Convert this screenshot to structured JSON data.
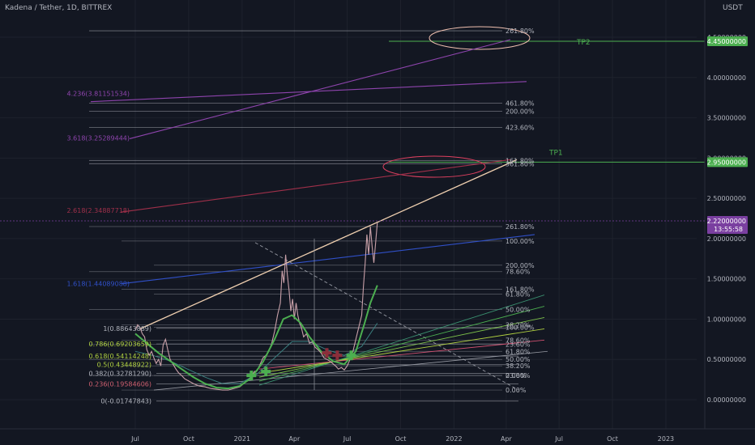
{
  "header": {
    "symbol_title": "Kadena / Tether, 1D, BITTREX",
    "currency": "USDT"
  },
  "colors": {
    "background": "#131722",
    "grid": "#1e222d",
    "axis_text": "#b2b5be",
    "fib_line": "#9598a1",
    "trend_line": "#f0d0b0",
    "candle": "#c8a0a8",
    "green_ma": "#4caf50",
    "buy_marker": "#4caf50",
    "sell_marker": "#8b2e3a",
    "ext_purple": "#8e44ad",
    "ext_blue": "#3050c8",
    "ext_red": "#a0304a",
    "tp_green": "#4caf50",
    "price_label": "#7a3fa0"
  },
  "chart_data": {
    "type": "line",
    "title": "Kadena / Tether, 1D, BITTREX",
    "xlabel": "",
    "ylabel": "USDT",
    "ylim": [
      -0.12,
      4.95
    ],
    "y_ticks": [
      {
        "value": 0.0,
        "label": "0.00000000"
      },
      {
        "value": 0.5,
        "label": "0.50000000"
      },
      {
        "value": 1.0,
        "label": "1.00000000"
      },
      {
        "value": 1.5,
        "label": "1.50000000"
      },
      {
        "value": 2.0,
        "label": "2.00000000"
      },
      {
        "value": 2.5,
        "label": "2.50000000"
      },
      {
        "value": 3.0,
        "label": "3.00000000"
      },
      {
        "value": 3.5,
        "label": "3.50000000"
      },
      {
        "value": 4.0,
        "label": "4.00000000"
      },
      {
        "value": 4.5,
        "label": "4.50000000"
      }
    ],
    "x_ticks": [
      {
        "t": 0,
        "label": "Jul"
      },
      {
        "t": 92,
        "label": "Oct"
      },
      {
        "t": 184,
        "label": "2021"
      },
      {
        "t": 274,
        "label": "Apr"
      },
      {
        "t": 365,
        "label": "Jul"
      },
      {
        "t": 457,
        "label": "Oct"
      },
      {
        "t": 549,
        "label": "2022"
      },
      {
        "t": 639,
        "label": "Apr"
      },
      {
        "t": 730,
        "label": "Jul"
      },
      {
        "t": 822,
        "label": "Oct"
      },
      {
        "t": 914,
        "label": "2023"
      }
    ],
    "price_series": [
      [
        0,
        0.86
      ],
      [
        4,
        0.93
      ],
      [
        8,
        0.9
      ],
      [
        12,
        0.82
      ],
      [
        16,
        0.78
      ],
      [
        20,
        0.62
      ],
      [
        24,
        0.55
      ],
      [
        28,
        0.6
      ],
      [
        32,
        0.52
      ],
      [
        36,
        0.45
      ],
      [
        40,
        0.5
      ],
      [
        44,
        0.42
      ],
      [
        48,
        0.68
      ],
      [
        52,
        0.75
      ],
      [
        56,
        0.62
      ],
      [
        60,
        0.5
      ],
      [
        65,
        0.44
      ],
      [
        70,
        0.38
      ],
      [
        75,
        0.33
      ],
      [
        80,
        0.3
      ],
      [
        85,
        0.26
      ],
      [
        90,
        0.24
      ],
      [
        95,
        0.22
      ],
      [
        100,
        0.2
      ],
      [
        110,
        0.17
      ],
      [
        120,
        0.16
      ],
      [
        130,
        0.14
      ],
      [
        140,
        0.13
      ],
      [
        150,
        0.12
      ],
      [
        160,
        0.12
      ],
      [
        170,
        0.14
      ],
      [
        180,
        0.16
      ],
      [
        190,
        0.22
      ],
      [
        200,
        0.28
      ],
      [
        205,
        0.35
      ],
      [
        210,
        0.36
      ],
      [
        215,
        0.44
      ],
      [
        220,
        0.52
      ],
      [
        225,
        0.55
      ],
      [
        230,
        0.6
      ],
      [
        235,
        0.7
      ],
      [
        240,
        0.85
      ],
      [
        245,
        1.05
      ],
      [
        250,
        1.2
      ],
      [
        253,
        1.6
      ],
      [
        256,
        1.45
      ],
      [
        259,
        1.8
      ],
      [
        262,
        1.55
      ],
      [
        265,
        1.35
      ],
      [
        268,
        1.1
      ],
      [
        271,
        1.25
      ],
      [
        274,
        1.0
      ],
      [
        277,
        1.2
      ],
      [
        280,
        1.05
      ],
      [
        283,
        0.95
      ],
      [
        286,
        0.9
      ],
      [
        290,
        0.78
      ],
      [
        295,
        0.82
      ],
      [
        300,
        0.7
      ],
      [
        305,
        0.72
      ],
      [
        310,
        0.65
      ],
      [
        315,
        0.62
      ],
      [
        320,
        0.58
      ],
      [
        325,
        0.52
      ],
      [
        330,
        0.5
      ],
      [
        335,
        0.48
      ],
      [
        340,
        0.45
      ],
      [
        345,
        0.42
      ],
      [
        350,
        0.38
      ],
      [
        355,
        0.4
      ],
      [
        360,
        0.37
      ],
      [
        365,
        0.42
      ],
      [
        370,
        0.5
      ],
      [
        375,
        0.6
      ],
      [
        380,
        0.75
      ],
      [
        385,
        0.9
      ],
      [
        390,
        1.05
      ],
      [
        393,
        1.4
      ],
      [
        396,
        1.7
      ],
      [
        399,
        2.05
      ],
      [
        402,
        1.8
      ],
      [
        405,
        2.15
      ],
      [
        408,
        1.9
      ],
      [
        411,
        1.7
      ],
      [
        414,
        1.95
      ],
      [
        417,
        2.2
      ]
    ],
    "ema_green": [
      [
        0,
        0.82
      ],
      [
        20,
        0.7
      ],
      [
        40,
        0.58
      ],
      [
        60,
        0.48
      ],
      [
        80,
        0.38
      ],
      [
        100,
        0.28
      ],
      [
        120,
        0.2
      ],
      [
        140,
        0.15
      ],
      [
        160,
        0.14
      ],
      [
        180,
        0.17
      ],
      [
        200,
        0.27
      ],
      [
        220,
        0.47
      ],
      [
        240,
        0.75
      ],
      [
        255,
        1.0
      ],
      [
        270,
        1.05
      ],
      [
        285,
        0.95
      ],
      [
        300,
        0.78
      ],
      [
        320,
        0.6
      ],
      [
        340,
        0.48
      ],
      [
        360,
        0.44
      ],
      [
        380,
        0.6
      ],
      [
        395,
        0.95
      ],
      [
        405,
        1.2
      ],
      [
        417,
        1.42
      ]
    ],
    "sma_slow": [
      [
        0,
        0.6
      ],
      [
        30,
        0.55
      ],
      [
        60,
        0.48
      ],
      [
        90,
        0.38
      ],
      [
        120,
        0.28
      ],
      [
        150,
        0.2
      ],
      [
        180,
        0.2
      ],
      [
        210,
        0.32
      ],
      [
        240,
        0.52
      ],
      [
        270,
        0.72
      ],
      [
        300,
        0.72
      ],
      [
        330,
        0.62
      ],
      [
        360,
        0.55
      ],
      [
        390,
        0.66
      ],
      [
        417,
        0.95
      ]
    ],
    "buy_markers": [
      [
        200,
        0.3
      ],
      [
        225,
        0.35
      ],
      [
        372,
        0.55
      ]
    ],
    "sell_markers": [
      [
        330,
        0.58
      ],
      [
        348,
        0.55
      ]
    ],
    "fib_retracement": [
      {
        "label": "1(0.88643889)",
        "value": 0.8864
      },
      {
        "label": "0.786(0.69203659)",
        "value": 0.692
      },
      {
        "label": "0.618(0.54114248)",
        "value": 0.5411
      },
      {
        "label": "0.5(0.43448922)",
        "value": 0.4345
      },
      {
        "label": "0.382(0.32781290)",
        "value": 0.3278
      },
      {
        "label": "0.236(0.19584606)",
        "value": 0.1958
      },
      {
        "label": "0(-0.01747843)",
        "value": -0.0175
      }
    ],
    "fib_extension_labels": [
      {
        "label": "1.618(1.44089088)",
        "value": 1.44,
        "color": "#3050c8"
      },
      {
        "label": "2.618(2.34887718)",
        "value": 2.35,
        "color": "#a0304a"
      },
      {
        "label": "3.618(3.25289444)",
        "value": 3.25,
        "color": "#8e44ad"
      },
      {
        "label": "4.236(3.81151534)",
        "value": 3.8,
        "color": "#8e44ad"
      }
    ],
    "fib_upper_levels": [
      {
        "label": "261.80%",
        "value": 4.58
      },
      {
        "label": "461.80%",
        "value": 3.68
      },
      {
        "label": "200.00%",
        "value": 3.58
      },
      {
        "label": "423.60%",
        "value": 3.38
      },
      {
        "label": "161.80%",
        "value": 2.97
      },
      {
        "label": "361.80%",
        "value": 2.93
      }
    ],
    "fib_lower_levels": [
      {
        "label": "261.80%",
        "value": 2.15
      },
      {
        "label": "100.00%",
        "value": 1.97
      },
      {
        "label": "200.00%",
        "value": 1.67
      },
      {
        "label": "78.60%",
        "value": 1.59
      },
      {
        "label": "161.80%",
        "value": 1.37
      },
      {
        "label": "61.80%",
        "value": 1.31
      },
      {
        "label": "50.00%",
        "value": 1.12
      },
      {
        "label": "38.20%",
        "value": 0.93
      },
      {
        "label": "100.00%",
        "value": 0.9
      },
      {
        "label": "23.60%",
        "value": 0.69
      },
      {
        "label": "78.60%",
        "value": 0.74
      },
      {
        "label": "61.80%",
        "value": 0.6
      },
      {
        "label": "50.00%",
        "value": 0.5
      },
      {
        "label": "38.20%",
        "value": 0.42
      },
      {
        "label": "0.00%",
        "value": 0.3
      },
      {
        "label": "23.60%",
        "value": 0.3
      },
      {
        "label": "0.00%",
        "value": 0.12
      }
    ],
    "targets": [
      {
        "name": "TP1",
        "value": 2.95,
        "label": "2.95000000"
      },
      {
        "name": "TP2",
        "value": 4.45,
        "label": "4.45000000"
      }
    ],
    "current_price": {
      "label": "2.22000000",
      "countdown": "13:55:58",
      "value": 2.22
    }
  }
}
